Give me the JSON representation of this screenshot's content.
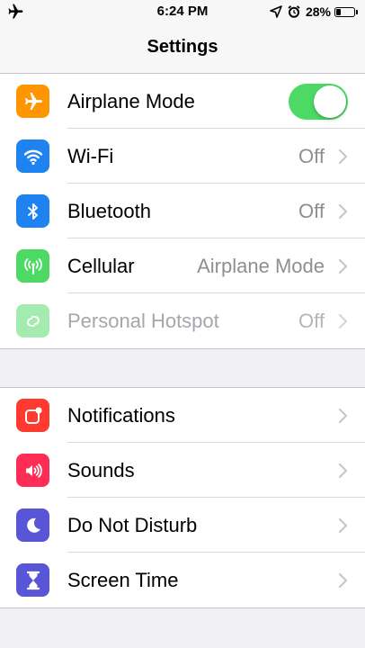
{
  "status_bar": {
    "time": "6:24 PM",
    "battery_percent": "28%",
    "battery_level": 0.28,
    "icons": [
      "airplane-icon",
      "location-arrow-icon",
      "alarm-icon",
      "battery-icon"
    ]
  },
  "nav": {
    "title": "Settings"
  },
  "colors": {
    "airplane": "#ff9500",
    "wifi": "#1e82f0",
    "bluetooth": "#1e82f0",
    "cellular": "#4cd964",
    "hotspot": "#4cd964",
    "notifications": "#ff3b30",
    "sounds": "#ff2d55",
    "dnd": "#5856d6",
    "screentime": "#5856d6",
    "toggle_on": "#4cd964"
  },
  "group1": {
    "items": [
      {
        "label": "Airplane Mode",
        "icon": "airplane-icon",
        "toggle_on": true
      },
      {
        "label": "Wi-Fi",
        "icon": "wifi-icon",
        "value": "Off"
      },
      {
        "label": "Bluetooth",
        "icon": "bluetooth-icon",
        "value": "Off"
      },
      {
        "label": "Cellular",
        "icon": "cellular-antenna-icon",
        "value": "Airplane Mode"
      },
      {
        "label": "Personal Hotspot",
        "icon": "hotspot-link-icon",
        "value": "Off",
        "disabled": true
      }
    ]
  },
  "group2": {
    "items": [
      {
        "label": "Notifications",
        "icon": "notifications-icon"
      },
      {
        "label": "Sounds",
        "icon": "speaker-icon"
      },
      {
        "label": "Do Not Disturb",
        "icon": "moon-icon"
      },
      {
        "label": "Screen Time",
        "icon": "hourglass-icon"
      }
    ]
  }
}
